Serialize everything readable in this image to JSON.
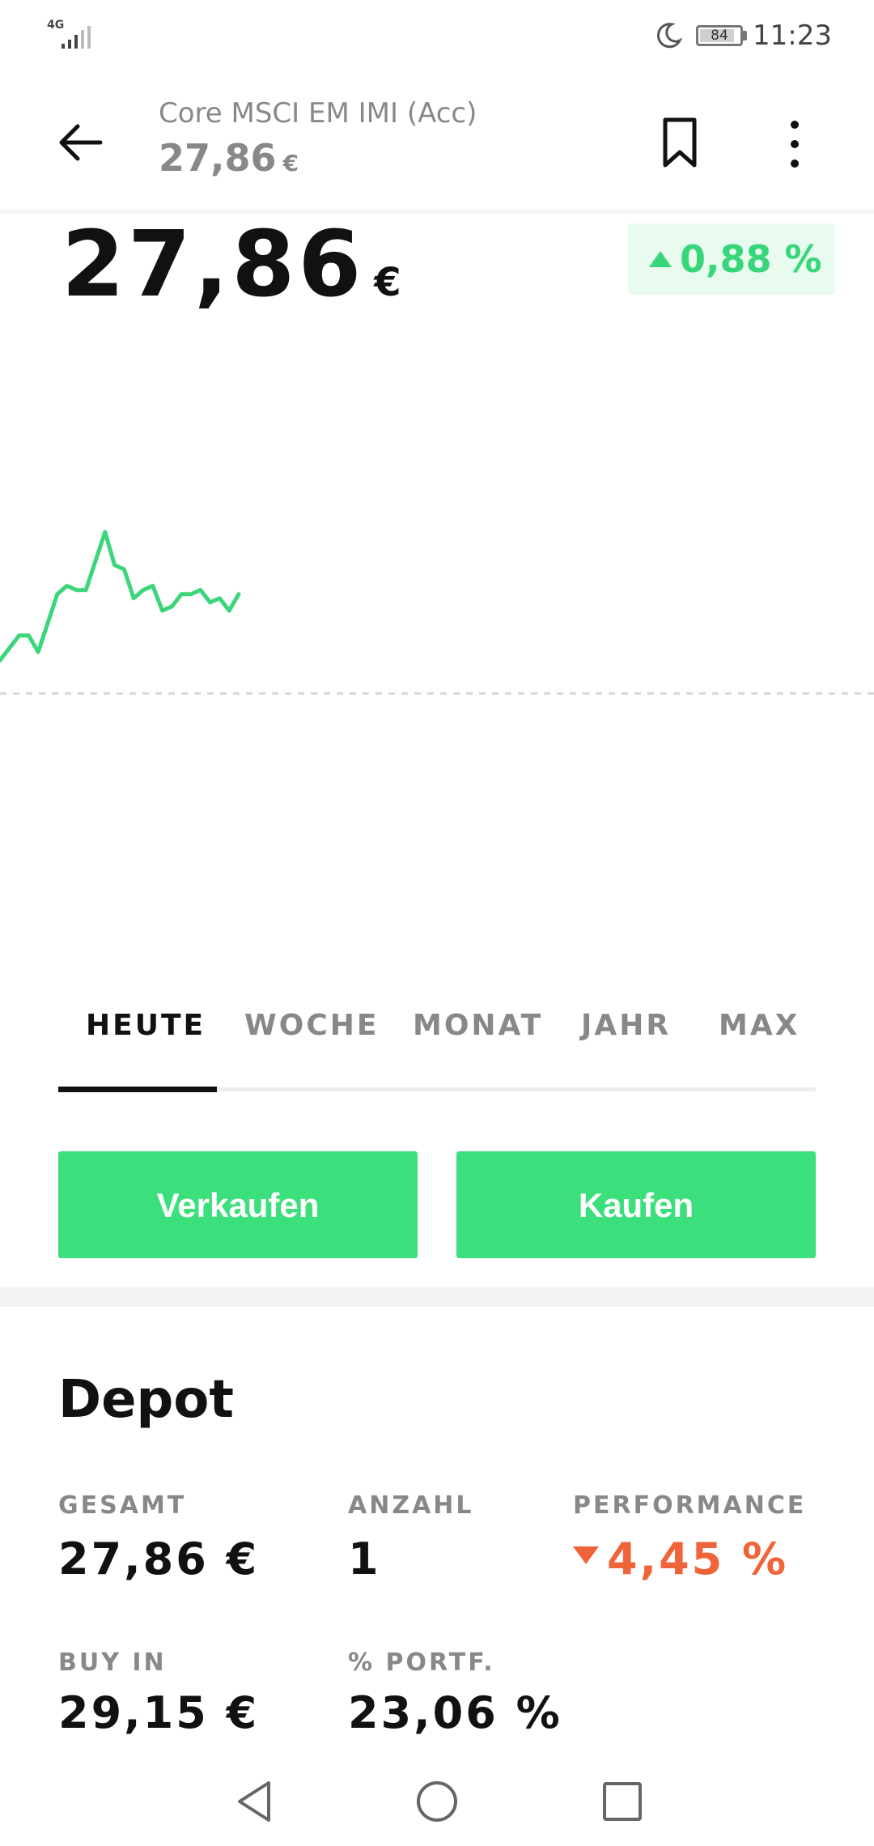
{
  "status_bar": {
    "network": "4G",
    "signal_icon": "signal-icon",
    "moon_icon": "moon-icon",
    "battery_level": "84",
    "time": "11:23"
  },
  "header": {
    "back_icon": "arrow-left-icon",
    "title": "Core MSCI EM IMI (Acc)",
    "price": "27,86",
    "currency": "€",
    "bookmark_icon": "bookmark-icon",
    "more_icon": "more-vertical-icon"
  },
  "quote": {
    "price": "27,86",
    "currency": "€",
    "change": "0,88 %",
    "change_direction": "up",
    "positive_color": "#38d67a"
  },
  "chart_data": {
    "type": "line",
    "series": [
      {
        "values": [
          27.7,
          27.73,
          27.76,
          27.76,
          27.72,
          27.79,
          27.86,
          27.88,
          27.87,
          27.87,
          27.94,
          28.01,
          27.93,
          27.92,
          27.85,
          27.87,
          27.88,
          27.82,
          27.83,
          27.86,
          27.86,
          27.87,
          27.84,
          27.85,
          27.82,
          27.86
        ]
      }
    ],
    "baseline": 27.62,
    "ylim": [
      27.3,
      28.2
    ],
    "grid": false,
    "line_color": "#3bd67a"
  },
  "tabs": [
    {
      "label": "HEUTE",
      "active": true
    },
    {
      "label": "WOCHE",
      "active": false
    },
    {
      "label": "MONAT",
      "active": false
    },
    {
      "label": "JAHR",
      "active": false
    },
    {
      "label": "MAX",
      "active": false
    }
  ],
  "actions": {
    "sell_label": "Verkaufen",
    "buy_label": "Kaufen",
    "button_color": "#3bdf7b"
  },
  "depot": {
    "title": "Depot",
    "total_label": "GESAMT",
    "total_value": "27,86 €",
    "count_label": "ANZAHL",
    "count_value": "1",
    "performance_label": "PERFORMANCE",
    "performance_value": "4,45 %",
    "performance_direction": "down",
    "negative_color": "#f0643a",
    "buyin_label": "BUY IN",
    "buyin_value": "29,15 €",
    "portf_label": "% PORTF.",
    "portf_value": "23,06 %"
  },
  "navbar": {
    "back_icon": "nav-back-icon",
    "home_icon": "nav-home-icon",
    "recents_icon": "nav-recents-icon"
  }
}
